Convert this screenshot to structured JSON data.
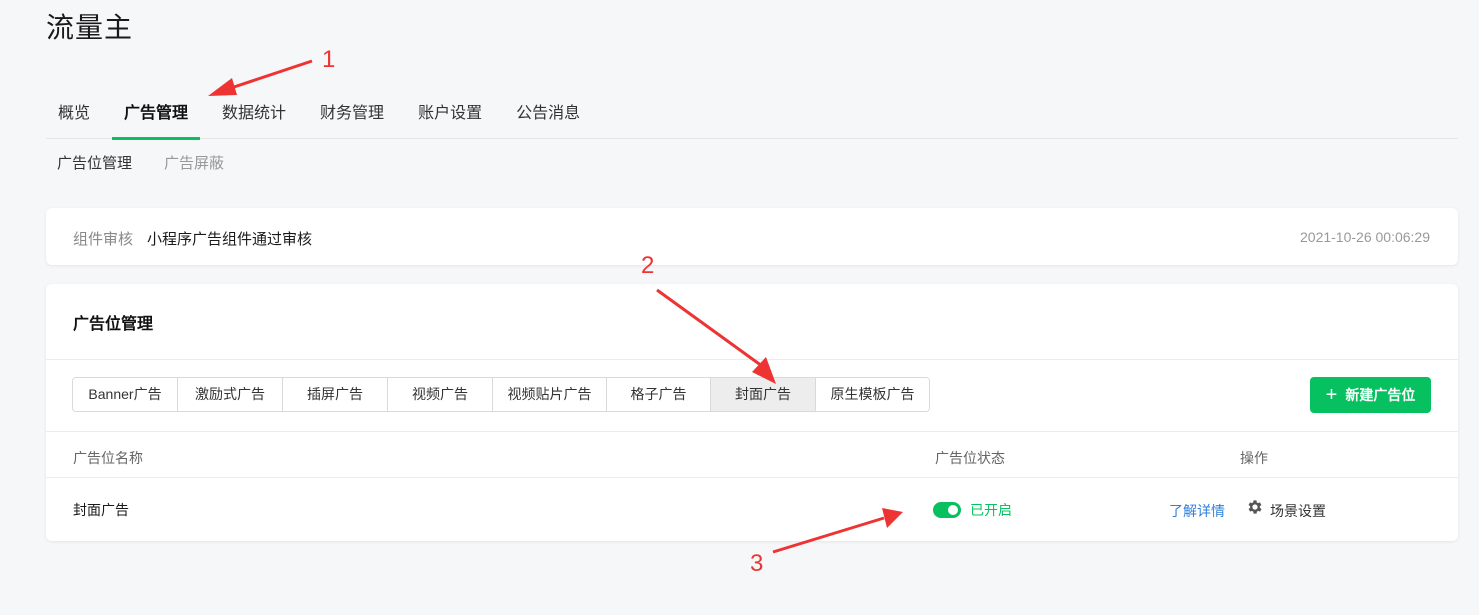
{
  "app": {
    "title": "流量主"
  },
  "main_tabs": [
    {
      "label": "概览",
      "active": false
    },
    {
      "label": "广告管理",
      "active": true
    },
    {
      "label": "数据统计",
      "active": false
    },
    {
      "label": "财务管理",
      "active": false
    },
    {
      "label": "账户设置",
      "active": false
    },
    {
      "label": "公告消息",
      "active": false
    }
  ],
  "sub_tabs": [
    {
      "label": "广告位管理",
      "active": true
    },
    {
      "label": "广告屏蔽",
      "active": false
    }
  ],
  "notice": {
    "label": "组件审核",
    "text": "小程序广告组件通过审核",
    "time": "2021-10-26 00:06:29"
  },
  "ad_panel": {
    "title": "广告位管理",
    "type_tabs": [
      {
        "label": "Banner广告",
        "active": false
      },
      {
        "label": "激励式广告",
        "active": false
      },
      {
        "label": "插屏广告",
        "active": false
      },
      {
        "label": "视频广告",
        "active": false
      },
      {
        "label": "视频贴片广告",
        "active": false
      },
      {
        "label": "格子广告",
        "active": false
      },
      {
        "label": "封面广告",
        "active": true
      },
      {
        "label": "原生模板广告",
        "active": false
      }
    ],
    "new_button": {
      "icon": "plus-icon",
      "label": "新建广告位"
    },
    "table": {
      "headers": {
        "name": "广告位名称",
        "status": "广告位状态",
        "actions": "操作"
      },
      "rows": [
        {
          "name": "封面广告",
          "status_on": true,
          "status_text": "已开启",
          "action_detail": "了解详情",
          "action_settings_icon": "gear-icon",
          "action_settings": "场景设置"
        }
      ]
    }
  },
  "annotations": [
    "1",
    "2",
    "3"
  ],
  "colors": {
    "accent": "#07c160",
    "link": "#2f7fdc",
    "annotation": "#ee3333"
  }
}
